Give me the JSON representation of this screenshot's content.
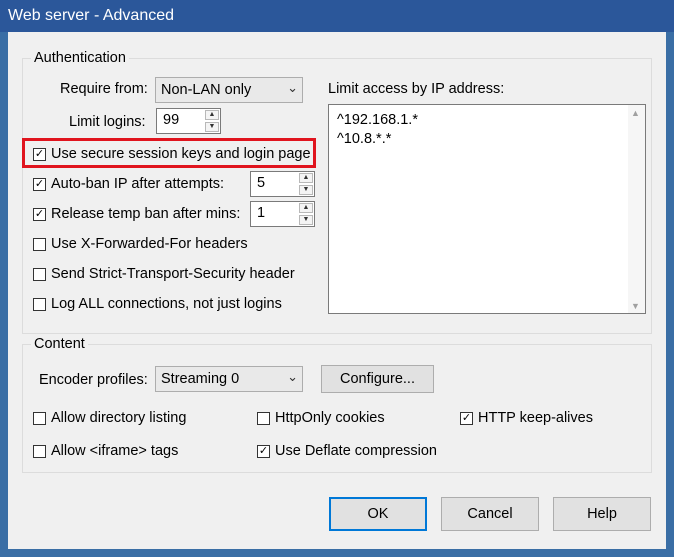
{
  "window": {
    "title": "Web server - Advanced"
  },
  "auth": {
    "legend": "Authentication",
    "require_from_label": "Require from:",
    "require_from_value": "Non-LAN only",
    "limit_logins_label": "Limit logins:",
    "limit_logins_value": "99",
    "secure_keys": {
      "label": "Use secure session keys and login page",
      "checked": true
    },
    "auto_ban": {
      "label": "Auto-ban IP after attempts:",
      "checked": true,
      "value": "5"
    },
    "release_ban": {
      "label": "Release temp ban after mins:",
      "checked": true,
      "value": "1"
    },
    "x_forwarded": {
      "label": "Use X-Forwarded-For headers",
      "checked": false
    },
    "strict_transport": {
      "label": "Send Strict-Transport-Security header",
      "checked": false
    },
    "log_all": {
      "label": "Log ALL connections, not just logins",
      "checked": false
    },
    "ip_limit_label": "Limit access by IP address:",
    "ip_entries": [
      "^192.168.1.*",
      "^10.8.*.*"
    ]
  },
  "content": {
    "legend": "Content",
    "encoder_label": "Encoder profiles:",
    "encoder_value": "Streaming 0",
    "configure_label": "Configure...",
    "allow_dir": {
      "label": "Allow directory listing",
      "checked": false
    },
    "allow_iframe": {
      "label": "Allow <iframe> tags",
      "checked": false
    },
    "httponly": {
      "label": "HttpOnly cookies",
      "checked": false
    },
    "deflate": {
      "label": "Use Deflate compression",
      "checked": true
    },
    "keepalive": {
      "label": "HTTP keep-alives",
      "checked": true
    }
  },
  "buttons": {
    "ok": "OK",
    "cancel": "Cancel",
    "help": "Help"
  },
  "check_glyph": "✓",
  "arrows": {
    "down": "⌄",
    "up": "▲",
    "dn": "▼",
    "scroll_up": "▲",
    "scroll_down": "▼"
  },
  "colors": {
    "titlebar": "#2b579a",
    "highlight": "#e0141e",
    "default_button_border": "#0078d7"
  }
}
